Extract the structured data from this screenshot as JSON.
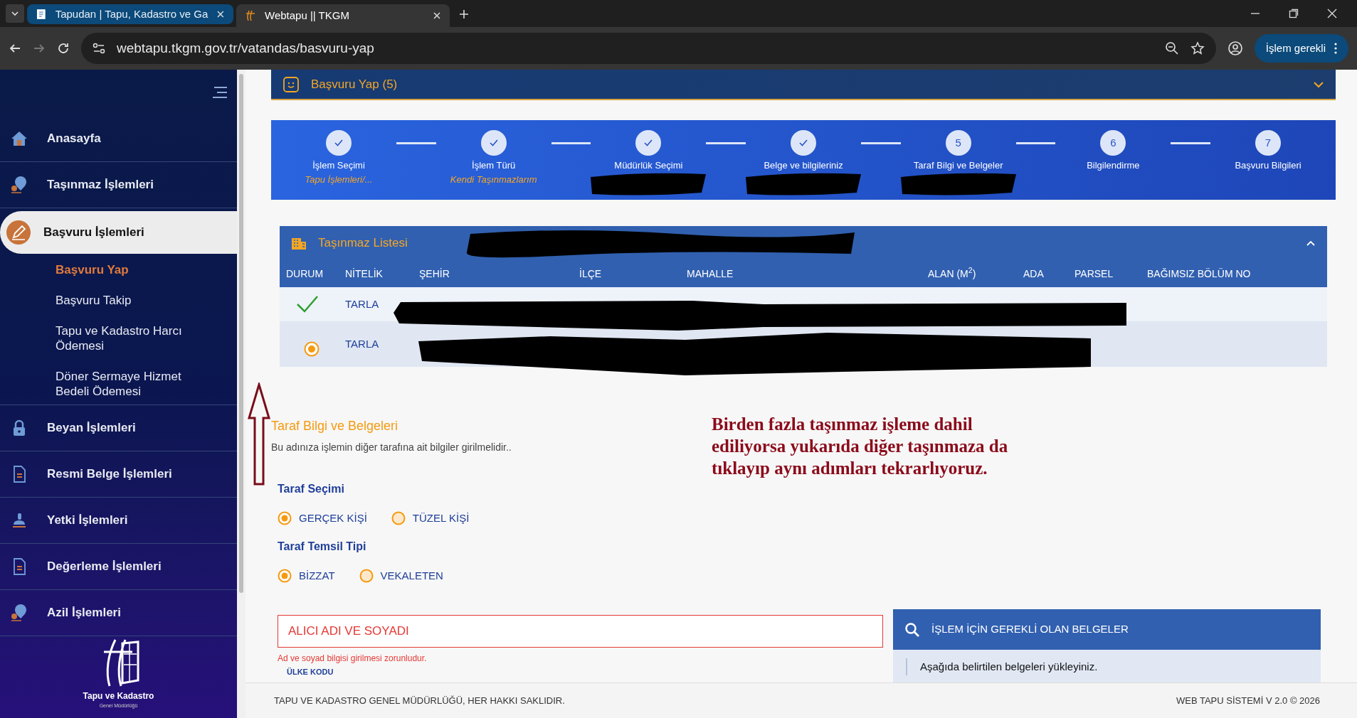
{
  "browser": {
    "tabs": [
      {
        "title": "Tapudan | Tapu, Kadastro ve Ga",
        "selected": false
      },
      {
        "title": "Webtapu || TKGM",
        "selected": true
      }
    ],
    "url": "webtapu.tkgm.gov.tr/vatandas/basvuru-yap",
    "action_button": "İşlem gerekli"
  },
  "sidebar": {
    "items": [
      {
        "label": "Anasayfa",
        "selected": false
      },
      {
        "label": "Taşınmaz İşlemleri",
        "selected": false
      },
      {
        "label": "Başvuru İşlemleri",
        "selected": true,
        "children": [
          {
            "label": "Başvuru Yap",
            "selected": true
          },
          {
            "label": "Başvuru Takip",
            "selected": false
          },
          {
            "label": "Tapu ve Kadastro Harcı Ödemesi",
            "selected": false
          },
          {
            "label": "Döner Sermaye Hizmet Bedeli Ödemesi",
            "selected": false
          }
        ]
      },
      {
        "label": "Beyan İşlemleri",
        "selected": false
      },
      {
        "label": "Resmi Belge İşlemleri",
        "selected": false
      },
      {
        "label": "Yetki İşlemleri",
        "selected": false
      },
      {
        "label": "Değerleme İşlemleri",
        "selected": false
      },
      {
        "label": "Azil İşlemleri",
        "selected": false
      }
    ],
    "logo_title": "Tapu ve Kadastro",
    "logo_subtitle": "Genel Müdürlüğü"
  },
  "header": {
    "title": "Başvuru Yap (5)"
  },
  "stepper": {
    "steps": [
      {
        "label": "İşlem Seçimi",
        "done": true,
        "subtitle": "Tapu İşlemleri/...",
        "redacted": false
      },
      {
        "label": "İşlem Türü",
        "done": true,
        "subtitle": "Kendi Taşınmazlarım",
        "redacted": false
      },
      {
        "label": "Müdürlük Seçimi",
        "done": true,
        "redacted": true
      },
      {
        "label": "Belge ve bilgileriniz",
        "done": true,
        "redacted": true
      },
      {
        "label": "Taraf Bilgi ve Belgeler",
        "number": "5",
        "done": false,
        "redacted": true
      },
      {
        "label": "Bilgilendirme",
        "number": "6",
        "done": false,
        "redacted": false
      },
      {
        "label": "Başvuru Bilgileri",
        "number": "7",
        "done": false,
        "redacted": false
      }
    ]
  },
  "property_table": {
    "title": "Taşınmaz Listesi",
    "columns": [
      "DURUM",
      "NİTELİK",
      "ŞEHİR",
      "İLÇE",
      "MAHALLE",
      "ALAN (M$^{2}$)",
      "ADA",
      "PARSEL",
      "BAĞIMSIZ BÖLÜM NO"
    ],
    "rows": [
      {
        "kind": "done",
        "nitelik": "TARLA"
      },
      {
        "kind": "current",
        "nitelik": "TARLA"
      }
    ]
  },
  "party_section": {
    "title": "Taraf Bilgi ve Belgeleri",
    "description": "Bu adınıza işlemin diğer tarafına ait bilgiler girilmelidir..",
    "groups": [
      {
        "label": "Taraf Seçimi",
        "options": [
          {
            "label": "GERÇEK KİŞİ",
            "selected": true
          },
          {
            "label": "TÜZEL KİŞİ",
            "selected": false
          }
        ]
      },
      {
        "label": "Taraf Temsil Tipi",
        "options": [
          {
            "label": "BİZZAT",
            "selected": true
          },
          {
            "label": "VEKALETEN",
            "selected": false
          }
        ]
      }
    ],
    "name_field": {
      "placeholder": "ALICI ADI VE SOYADI",
      "error": "Ad ve soyad bilgisi girilmesi zorunludur."
    },
    "next_label": "ÜLKE KODU"
  },
  "documents_panel": {
    "title": "İŞLEM İÇİN GEREKLİ OLAN BELGELER",
    "text": "Aşağıda belirtilen belgeleri yükleyiniz."
  },
  "annotation": {
    "text": "Birden fazla taşınmaz işleme dahil ediliyorsa yukarıda diğer taşınmaza da tıklayıp aynı adımları tekrarlıyoruz."
  },
  "footer": {
    "left": "TAPU VE KADASTRO GENEL MÜDÜRLÜĞÜ, HER HAKKI SAKLIDIR.",
    "right": "WEB TAPU SİSTEMİ V 2.0 © 2026"
  }
}
